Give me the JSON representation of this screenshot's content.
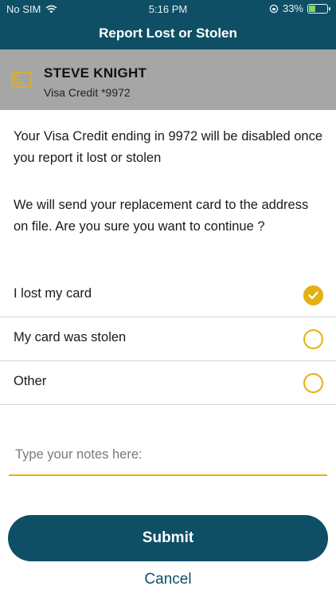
{
  "status_bar": {
    "carrier": "No SIM",
    "time": "5:16 PM",
    "battery_percent": "33%",
    "icons": [
      "wifi-icon",
      "orientation-lock-icon",
      "battery-charging-icon"
    ]
  },
  "header": {
    "title": "Report Lost or Stolen"
  },
  "card": {
    "holder_name": "STEVE KNIGHT",
    "description": "Visa Credit *9972",
    "icon": "credit-card-icon"
  },
  "messages": {
    "disable_notice": "Your Visa Credit ending in 9972 will be disabled once you report it lost or stolen",
    "replacement_notice": "We will send your replacement card to the address on file. Are you sure you want to continue ?"
  },
  "options": [
    {
      "label": "I lost my card",
      "selected": true
    },
    {
      "label": "My card was stolen",
      "selected": false
    },
    {
      "label": "Other",
      "selected": false
    }
  ],
  "notes": {
    "placeholder": "Type your notes here:",
    "value": ""
  },
  "actions": {
    "submit_label": "Submit",
    "cancel_label": "Cancel"
  },
  "colors": {
    "primary": "#0e4f66",
    "accent": "#e5b012",
    "banner": "#a6a6a6"
  }
}
